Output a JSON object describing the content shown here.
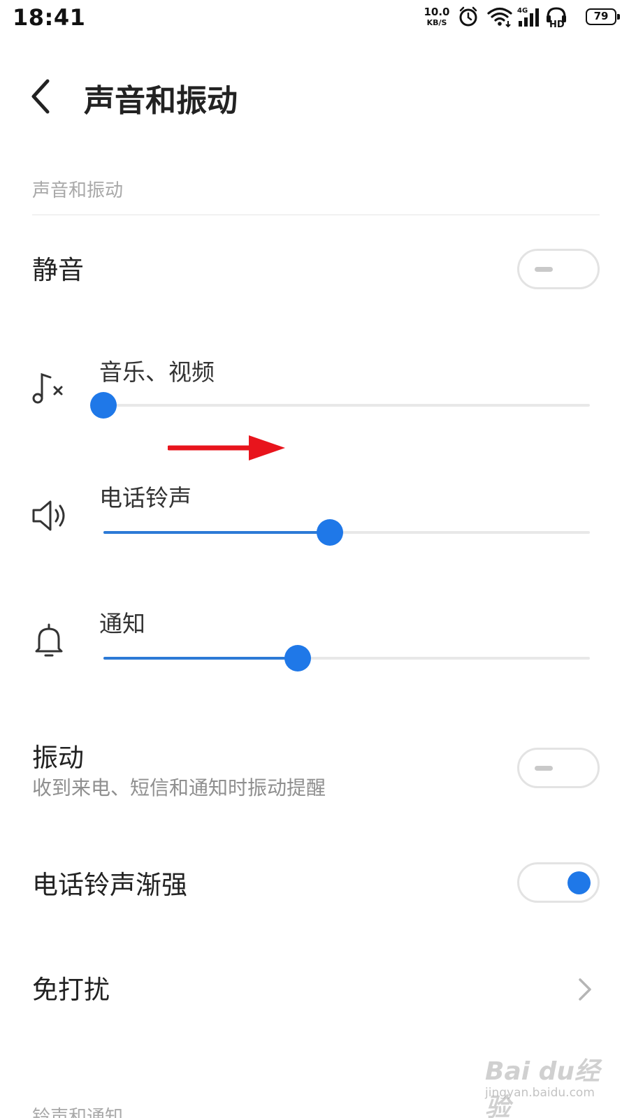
{
  "status_bar": {
    "time": "18:41",
    "net_speed": "10.0",
    "net_speed_unit": "KB/S",
    "network_type": "4G",
    "hd_label": "HD",
    "battery": "79",
    "icons": [
      "alarm-icon",
      "wifi-icon",
      "signal-icon",
      "hd-voice-icon",
      "battery-icon"
    ]
  },
  "header": {
    "title": "声音和振动"
  },
  "section_sound": {
    "title": "声音和振动"
  },
  "mute": {
    "label": "静音",
    "on": false
  },
  "sliders": [
    {
      "label": "音乐、视频",
      "icon": "music-muted-icon",
      "level": 0.0
    },
    {
      "label": "电话铃声",
      "icon": "speaker-icon",
      "level": 0.465
    },
    {
      "label": "通知",
      "icon": "bell-icon",
      "level": 0.4
    }
  ],
  "vibration": {
    "label": "振动",
    "sublabel": "收到来电、短信和通知时振动提醒",
    "on": false
  },
  "ringtone_fade": {
    "label": "电话铃声渐强",
    "on": true
  },
  "dnd": {
    "label": "免打扰"
  },
  "section_ringtone": {
    "title": "铃声和通知"
  },
  "watermark": {
    "brand": "Bai du经验",
    "url": "jingyan.baidu.com"
  },
  "colors": {
    "accent": "#1f78e8",
    "annotation_arrow": "#e8141c"
  }
}
